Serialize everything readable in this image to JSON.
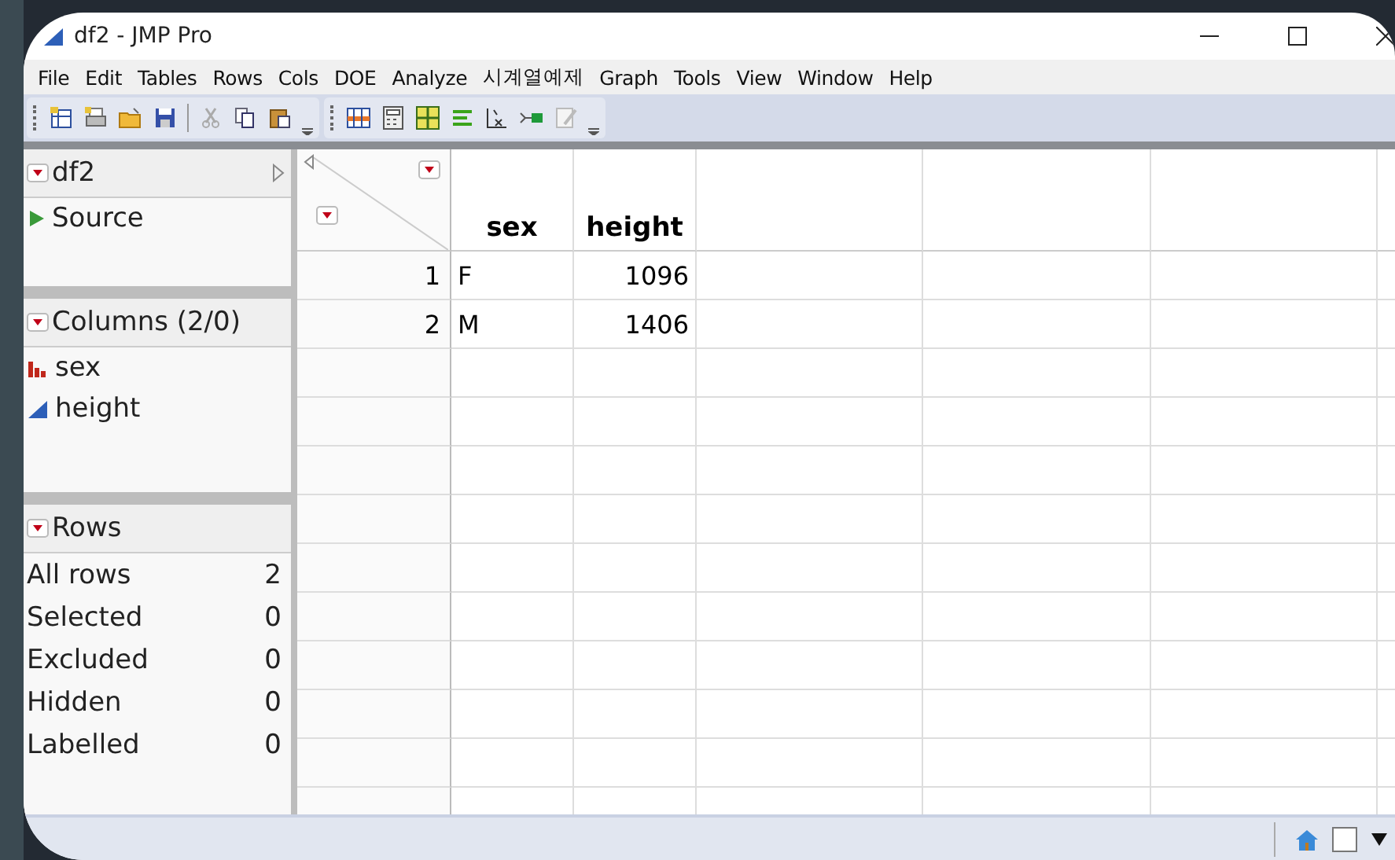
{
  "window": {
    "title": "df2 - JMP Pro"
  },
  "menu": [
    "File",
    "Edit",
    "Tables",
    "Rows",
    "Cols",
    "DOE",
    "Analyze",
    "시계열예제",
    "Graph",
    "Tools",
    "View",
    "Window",
    "Help"
  ],
  "table_panel": {
    "title": "df2",
    "items": [
      {
        "label": "Source"
      }
    ]
  },
  "columns_panel": {
    "title": "Columns (2/0)",
    "columns": [
      {
        "name": "sex",
        "kind": "nominal"
      },
      {
        "name": "height",
        "kind": "continuous"
      }
    ]
  },
  "rows_panel": {
    "title": "Rows",
    "stats": [
      {
        "label": "All rows",
        "value": "2"
      },
      {
        "label": "Selected",
        "value": "0"
      },
      {
        "label": "Excluded",
        "value": "0"
      },
      {
        "label": "Hidden",
        "value": "0"
      },
      {
        "label": "Labelled",
        "value": "0"
      }
    ]
  },
  "grid": {
    "columns": [
      {
        "name": "sex",
        "kind": "nominal"
      },
      {
        "name": "height",
        "kind": "continuous"
      }
    ],
    "rows": [
      {
        "number": "1",
        "cells": [
          "F",
          "1096"
        ]
      },
      {
        "number": "2",
        "cells": [
          "M",
          "1406"
        ]
      }
    ]
  }
}
